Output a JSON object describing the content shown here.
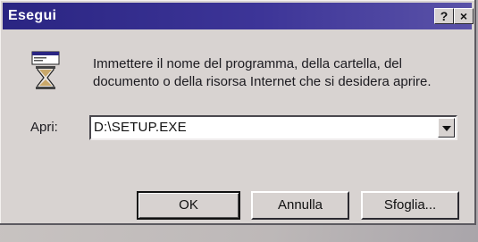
{
  "window": {
    "title": "Esegui",
    "help_label": "?",
    "close_label": "×"
  },
  "dialog": {
    "prompt": "Immettere il nome del programma, della cartella, del documento o della risorsa Internet che si desidera aprire.",
    "open_label": "Apri:",
    "open_value": "D:\\SETUP.EXE",
    "icon": "run-program-icon"
  },
  "buttons": {
    "ok": "OK",
    "cancel": "Annulla",
    "browse": "Sfoglia..."
  },
  "colors": {
    "titlebar": "#2a2582",
    "dialog_bg": "#d8d3d1"
  }
}
